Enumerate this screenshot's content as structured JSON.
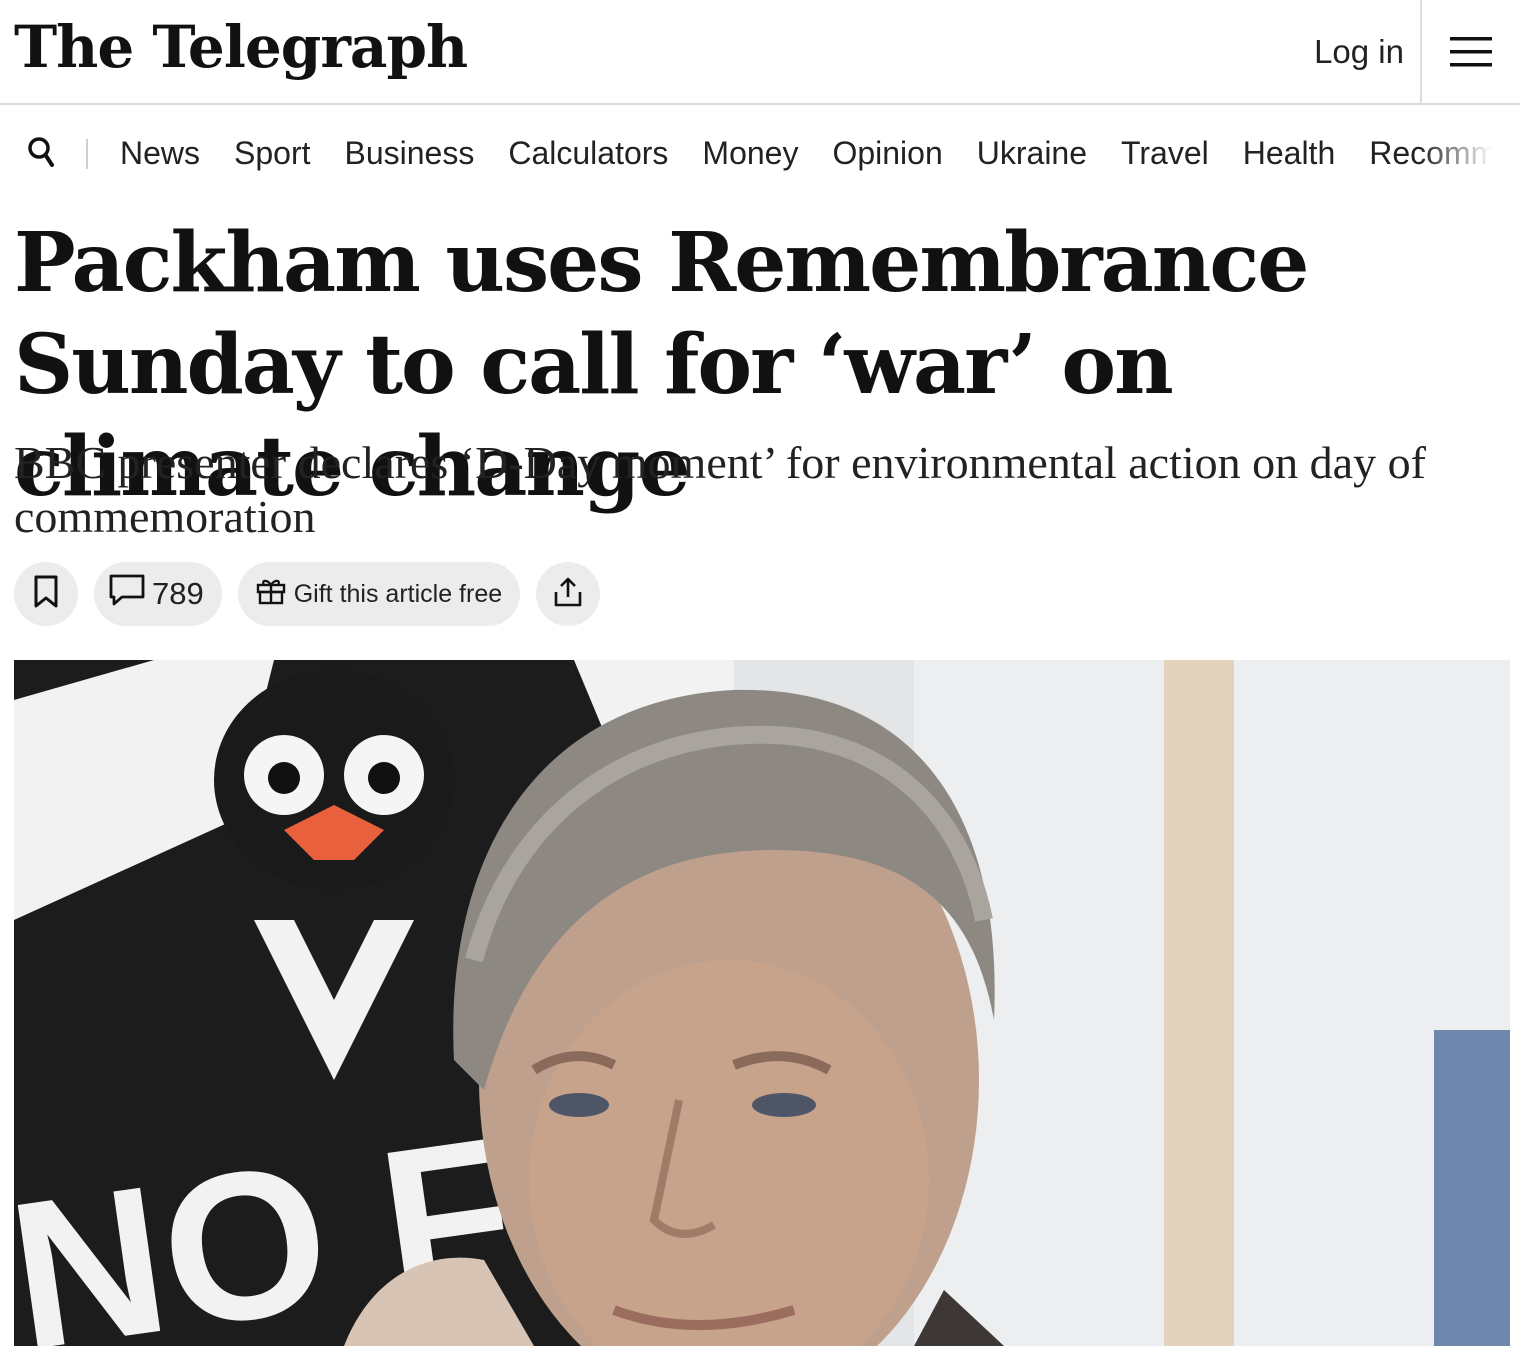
{
  "header": {
    "logo": "The Telegraph",
    "login_label": "Log in",
    "menu_icon": "hamburger-icon"
  },
  "nav": {
    "search_icon": "search-icon",
    "items": [
      "News",
      "Sport",
      "Business",
      "Calculators",
      "Money",
      "Opinion",
      "Ukraine",
      "Travel",
      "Health",
      "Recommended"
    ]
  },
  "article": {
    "headline": "Packham uses Remembrance Sunday to call for ‘war’ on climate change",
    "standfirst": "BBC presenter declares ‘D-Day moment’ for environmental action on day of commemoration",
    "actions": {
      "bookmark_icon": "bookmark-icon",
      "comment_icon": "comment-icon",
      "comment_count": "789",
      "gift_icon": "gift-icon",
      "gift_label": "Gift this article free",
      "share_icon": "share-icon"
    },
    "image": {
      "banner_text": "NO FR"
    }
  }
}
